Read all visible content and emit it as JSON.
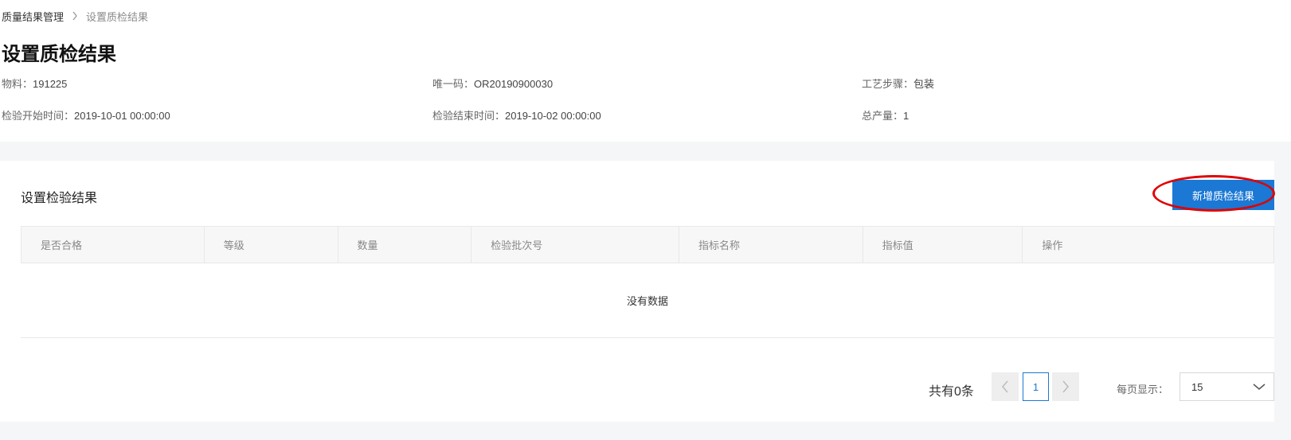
{
  "breadcrumb": {
    "root": "质量结果管理",
    "current": "设置质检结果"
  },
  "page_title": "设置质检结果",
  "info": {
    "material": {
      "label": "物料：",
      "value": "191225"
    },
    "unique_code": {
      "label": "唯一码：",
      "value": "OR20190900030"
    },
    "process_step": {
      "label": "工艺步骤：",
      "value": "包装"
    },
    "inspect_start": {
      "label": "检验开始时间：",
      "value": "2019-10-01 00:00:00"
    },
    "inspect_end": {
      "label": "检验结束时间：",
      "value": "2019-10-02 00:00:00"
    },
    "total_output": {
      "label": "总产量：",
      "value": "1"
    }
  },
  "section": {
    "title": "设置检验结果",
    "add_button": "新增质检结果"
  },
  "table": {
    "columns": [
      "是否合格",
      "等级",
      "数量",
      "检验批次号",
      "指标名称",
      "指标值",
      "操作"
    ],
    "empty_text": "没有数据"
  },
  "pagination": {
    "total_text": "共有0条",
    "current_page": "1",
    "page_size_label": "每页显示：",
    "page_size": "15"
  },
  "colors": {
    "primary": "#1b78d4",
    "highlight": "#e00000"
  },
  "icons": {
    "breadcrumb_separator": "chevron-right-icon",
    "prev": "chevron-left-icon",
    "next": "chevron-right-icon",
    "select": "chevron-down-icon"
  }
}
